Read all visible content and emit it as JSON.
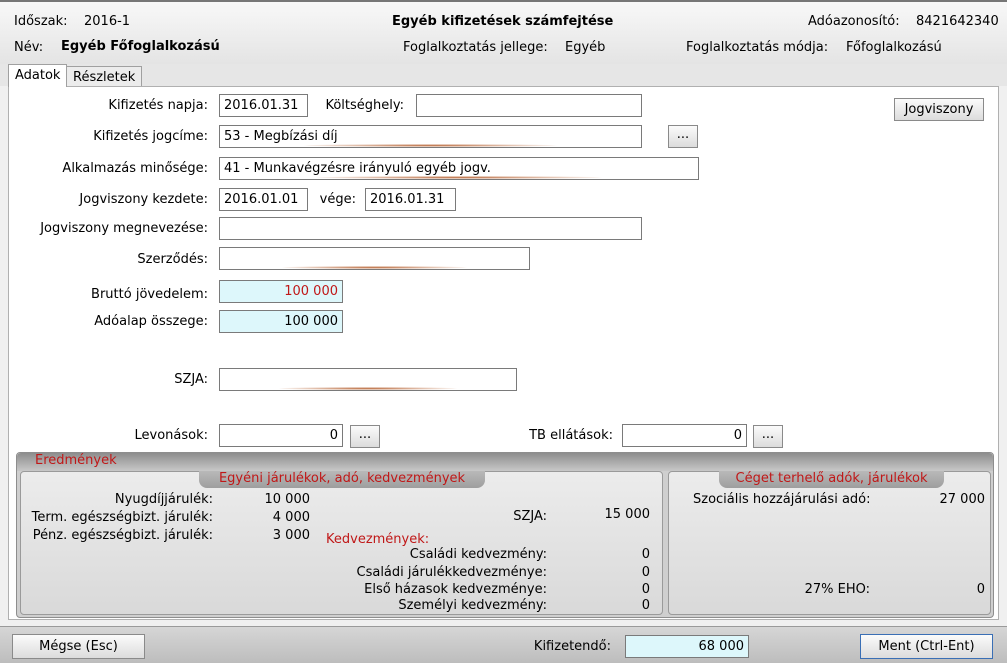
{
  "header": {
    "period_label": "Időszak:",
    "period_value": "2016-1",
    "title": "Egyéb kifizetések számfejtése",
    "tax_id_label": "Adóazonosító:",
    "tax_id_value": "8421642340",
    "name_label": "Név:",
    "name_value": "Egyéb Főfoglalkozású",
    "employment_type_label": "Foglalkoztatás jellege:",
    "employment_type_value": "Egyéb",
    "employment_mode_label": "Foglalkoztatás módja:",
    "employment_mode_value": "Főfoglalkozású"
  },
  "tabs": [
    {
      "label": "Adatok",
      "active": true
    },
    {
      "label": "Részletek",
      "active": false
    }
  ],
  "form": {
    "payment_date_label": "Kifizetés napja:",
    "payment_date_value": "2016.01.31",
    "cost_center_label": "Költséghely:",
    "cost_center_value": "",
    "legal_relation_button": "Jogviszony",
    "payment_title_label": "Kifizetés jogcíme:",
    "payment_title_value": "53 - Megbízási díj",
    "ellipsis": "...",
    "employment_quality_label": "Alkalmazás minősége:",
    "employment_quality_value": "41 - Munkavégzésre irányuló egyéb jogv.",
    "relation_start_label": "Jogviszony kezdete:",
    "relation_start_value": "2016.01.01",
    "relation_end_label": "vége:",
    "relation_end_value": "2016.01.31",
    "relation_name_label": "Jogviszony megnevezése:",
    "relation_name_value": "",
    "contract_label": "Szerződés:",
    "contract_value": "",
    "gross_income_label": "Bruttó jövedelem:",
    "gross_income_value": "100 000",
    "tax_base_label": "Adóalap összege:",
    "tax_base_value": "100 000",
    "szja_label": "SZJA:",
    "szja_value": "",
    "deductions_label": "Levonások:",
    "deductions_value": "0",
    "tb_label": "TB ellátások:",
    "tb_value": "0"
  },
  "results": {
    "title": "Eredmények",
    "individual_title": "Egyéni járulékok, adó, kedvezmények",
    "pension_label": "Nyugdíjjárulék:",
    "pension_value": "10 000",
    "health_in_kind_label": "Term. egészségbizt. járulék:",
    "health_in_kind_value": "4 000",
    "health_cash_label": "Pénz. egészségbizt. járulék:",
    "health_cash_value": "3 000",
    "szja_label": "SZJA:",
    "szja_value": "15 000",
    "allowances_title": "Kedvezmények:",
    "family_allowance_label": "Családi kedvezmény:",
    "family_allowance_value": "0",
    "family_contrib_allowance_label": "Családi járulékkedvezménye:",
    "family_contrib_allowance_value": "0",
    "first_marriage_label": "Első házasok kedvezménye:",
    "first_marriage_value": "0",
    "personal_allowance_label": "Személyi kedvezmény:",
    "personal_allowance_value": "0",
    "employer_title": "Céget terhelő adók, járulékok",
    "social_tax_label": "Szociális hozzájárulási adó:",
    "social_tax_value": "27 000",
    "eho_label": "27% EHO:",
    "eho_value": "0"
  },
  "footer": {
    "cancel_button": "Mégse (Esc)",
    "net_pay_label": "Kifizetendő:",
    "net_pay_value": "68 000",
    "save_button": "Ment (Ctrl-Ent)"
  },
  "colors": {
    "accent_red": "#c01818",
    "highlight_cyan": "#ddf7fb"
  }
}
